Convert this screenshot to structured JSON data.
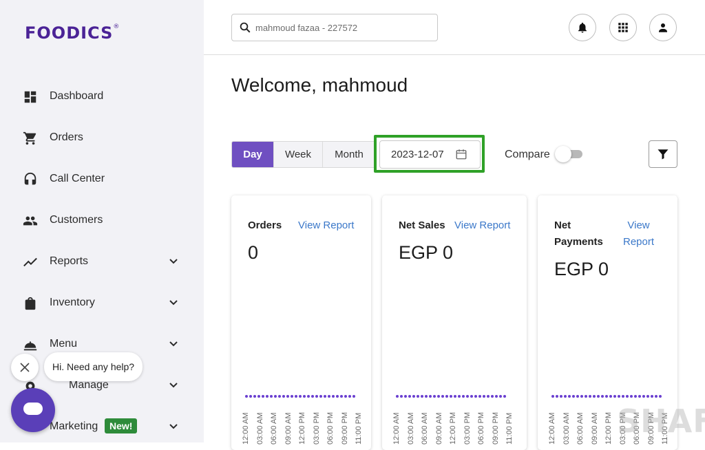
{
  "brand": {
    "logo": "FOODICS",
    "mark": "®"
  },
  "sidebar": {
    "items": [
      {
        "label": "Dashboard",
        "icon": "dashboard-icon"
      },
      {
        "label": "Orders",
        "icon": "cart-icon"
      },
      {
        "label": "Call Center",
        "icon": "headset-icon"
      },
      {
        "label": "Customers",
        "icon": "people-icon"
      },
      {
        "label": "Reports",
        "icon": "trending-icon"
      },
      {
        "label": "Inventory",
        "icon": "bag-icon"
      },
      {
        "label": "Menu",
        "icon": "food-icon"
      },
      {
        "label": "Manage",
        "icon": "gear-icon"
      },
      {
        "label": "Marketing",
        "icon": "megaphone-icon",
        "badge": "New!"
      }
    ]
  },
  "header": {
    "search_value": "mahmoud fazaa - 227572"
  },
  "main": {
    "welcome": "Welcome, mahmoud",
    "periods": [
      "Day",
      "Week",
      "Month"
    ],
    "active_period": "Day",
    "date": "2023-12-07",
    "compare_label": "Compare",
    "compare_on": false
  },
  "cards": [
    {
      "title": "Orders",
      "link": "View Report",
      "value": "0"
    },
    {
      "title": "Net Sales",
      "link": "View Report",
      "value": "EGP 0"
    },
    {
      "title": "Net Payments",
      "title_lines": [
        "Net",
        "Payments"
      ],
      "link_lines": [
        "View",
        "Report"
      ],
      "link": "View Report",
      "value": "EGP 0"
    }
  ],
  "time_ticks": [
    "12:00 AM",
    "03:00 AM",
    "06:00 AM",
    "09:00 AM",
    "12:00 PM",
    "03:00 PM",
    "06:00 PM",
    "09:00 PM",
    "11:00 PM"
  ],
  "help": {
    "message": "Hi. Need any help?"
  },
  "watermark": "SHAFT",
  "colors": {
    "accent": "#6f4fc1",
    "brand": "#4b2396",
    "highlight": "#2fa127",
    "link": "#3b78c9",
    "badge": "#2e8b3a"
  }
}
